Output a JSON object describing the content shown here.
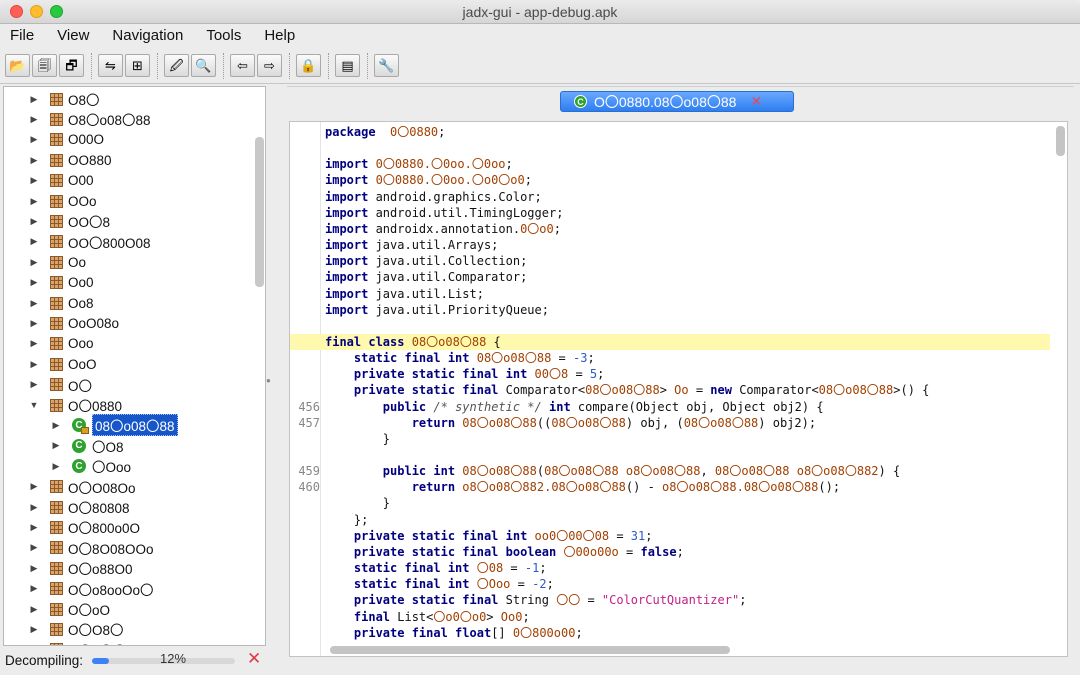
{
  "window": {
    "title": "jadx-gui - app-debug.apk"
  },
  "menu": [
    "File",
    "View",
    "Navigation",
    "Tools",
    "Help"
  ],
  "toolbar": {
    "groups": [
      [
        {
          "icon": "folder-open-icon",
          "glyph": "📂"
        },
        {
          "icon": "save-all-icon",
          "glyph": "🗐"
        },
        {
          "icon": "export-icon",
          "glyph": "🗗"
        }
      ],
      [
        {
          "icon": "sync-tree-icon",
          "glyph": "⇋"
        },
        {
          "icon": "flatten-packages-icon",
          "glyph": "⊞"
        }
      ],
      [
        {
          "icon": "search-text-icon",
          "glyph": "🖉"
        },
        {
          "icon": "search-class-icon",
          "glyph": "🔍"
        }
      ],
      [
        {
          "icon": "back-icon",
          "glyph": "⇦"
        },
        {
          "icon": "forward-icon",
          "glyph": "⇨"
        }
      ],
      [
        {
          "icon": "deobfuscation-icon",
          "glyph": "🔒"
        }
      ],
      [
        {
          "icon": "log-viewer-icon",
          "glyph": "▤"
        }
      ],
      [
        {
          "icon": "preferences-icon",
          "glyph": "🔧"
        }
      ]
    ]
  },
  "tree": [
    {
      "label": "O8〇",
      "type": "package",
      "level": 0,
      "arrow": "▶"
    },
    {
      "label": "O8〇o08〇88",
      "type": "package",
      "level": 0,
      "arrow": "▶"
    },
    {
      "label": "O00O",
      "type": "package",
      "level": 0,
      "arrow": "▶"
    },
    {
      "label": "OO880",
      "type": "package",
      "level": 0,
      "arrow": "▶"
    },
    {
      "label": "O00",
      "type": "package",
      "level": 0,
      "arrow": "▶"
    },
    {
      "label": "OOo",
      "type": "package",
      "level": 0,
      "arrow": "▶"
    },
    {
      "label": "OO〇8",
      "type": "package",
      "level": 0,
      "arrow": "▶"
    },
    {
      "label": "OO〇800O08",
      "type": "package",
      "level": 0,
      "arrow": "▶"
    },
    {
      "label": "Oo",
      "type": "package",
      "level": 0,
      "arrow": "▶"
    },
    {
      "label": "Oo0",
      "type": "package",
      "level": 0,
      "arrow": "▶"
    },
    {
      "label": "Oo8",
      "type": "package",
      "level": 0,
      "arrow": "▶"
    },
    {
      "label": "OoO08o",
      "type": "package",
      "level": 0,
      "arrow": "▶"
    },
    {
      "label": "Ooo",
      "type": "package",
      "level": 0,
      "arrow": "▶"
    },
    {
      "label": "OoO",
      "type": "package",
      "level": 0,
      "arrow": "▶"
    },
    {
      "label": "O〇",
      "type": "package",
      "level": 0,
      "arrow": "▶"
    },
    {
      "label": "O〇0880",
      "type": "package",
      "level": 0,
      "arrow": "▼"
    },
    {
      "label": "08〇o08〇88",
      "type": "class",
      "level": 1,
      "arrow": "▶",
      "selected": true,
      "lock": true
    },
    {
      "label": "〇O8",
      "type": "class",
      "level": 1,
      "arrow": "▶"
    },
    {
      "label": "〇Ooo",
      "type": "class",
      "level": 1,
      "arrow": "▶"
    },
    {
      "label": "O〇O08Oo",
      "type": "package",
      "level": 0,
      "arrow": "▶"
    },
    {
      "label": "O〇80808",
      "type": "package",
      "level": 0,
      "arrow": "▶"
    },
    {
      "label": "O〇800o0O",
      "type": "package",
      "level": 0,
      "arrow": "▶"
    },
    {
      "label": "O〇8O08OOo",
      "type": "package",
      "level": 0,
      "arrow": "▶"
    },
    {
      "label": "O〇o88O0",
      "type": "package",
      "level": 0,
      "arrow": "▶"
    },
    {
      "label": "O〇o8ooOo〇",
      "type": "package",
      "level": 0,
      "arrow": "▶"
    },
    {
      "label": "O〇oO",
      "type": "package",
      "level": 0,
      "arrow": "▶"
    },
    {
      "label": "O〇O8〇",
      "type": "package",
      "level": 0,
      "arrow": "▶"
    },
    {
      "label": "O〇0〇〇",
      "type": "package",
      "level": 0,
      "arrow": "▶"
    }
  ],
  "tab": {
    "label": "O〇0880.08〇o08〇88",
    "close": "✕",
    "icon_glyph": "C"
  },
  "code": [
    {
      "ln": "",
      "segs": [
        [
          "kw",
          "package"
        ],
        [
          "",
          "  "
        ],
        [
          "id",
          "0〇0880"
        ],
        [
          "",
          ";"
        ]
      ]
    },
    {
      "ln": "",
      "segs": []
    },
    {
      "ln": "",
      "segs": [
        [
          "kw",
          "import"
        ],
        [
          "",
          " "
        ],
        [
          "id",
          "0〇0880.〇0oo.〇0oo"
        ],
        [
          "",
          ";"
        ]
      ]
    },
    {
      "ln": "",
      "segs": [
        [
          "kw",
          "import"
        ],
        [
          "",
          " "
        ],
        [
          "id",
          "0〇0880.〇0oo.〇o0〇o0"
        ],
        [
          "",
          ";"
        ]
      ]
    },
    {
      "ln": "",
      "segs": [
        [
          "kw",
          "import"
        ],
        [
          "",
          " android.graphics.Color;"
        ]
      ]
    },
    {
      "ln": "",
      "segs": [
        [
          "kw",
          "import"
        ],
        [
          "",
          " android.util.TimingLogger;"
        ]
      ]
    },
    {
      "ln": "",
      "segs": [
        [
          "kw",
          "import"
        ],
        [
          "",
          " androidx.annotation."
        ],
        [
          "id",
          "0〇o0"
        ],
        [
          "",
          ";"
        ]
      ]
    },
    {
      "ln": "",
      "segs": [
        [
          "kw",
          "import"
        ],
        [
          "",
          " java.util.Arrays;"
        ]
      ]
    },
    {
      "ln": "",
      "segs": [
        [
          "kw",
          "import"
        ],
        [
          "",
          " java.util.Collection;"
        ]
      ]
    },
    {
      "ln": "",
      "segs": [
        [
          "kw",
          "import"
        ],
        [
          "",
          " java.util.Comparator;"
        ]
      ]
    },
    {
      "ln": "",
      "segs": [
        [
          "kw",
          "import"
        ],
        [
          "",
          " java.util.List;"
        ]
      ]
    },
    {
      "ln": "",
      "segs": [
        [
          "kw",
          "import"
        ],
        [
          "",
          " java.util.PriorityQueue;"
        ]
      ]
    },
    {
      "ln": "",
      "segs": []
    },
    {
      "ln": "",
      "hl": true,
      "segs": [
        [
          "kw",
          "final class"
        ],
        [
          "",
          " "
        ],
        [
          "id",
          "08〇o08〇88"
        ],
        [
          "",
          " {"
        ]
      ]
    },
    {
      "ln": "",
      "segs": [
        [
          "",
          "    "
        ],
        [
          "kw",
          "static final int"
        ],
        [
          "",
          " "
        ],
        [
          "id",
          "08〇o08〇88"
        ],
        [
          "",
          " = "
        ],
        [
          "num",
          "-3"
        ],
        [
          "",
          ";"
        ]
      ]
    },
    {
      "ln": "",
      "segs": [
        [
          "",
          "    "
        ],
        [
          "kw",
          "private static final int"
        ],
        [
          "",
          " "
        ],
        [
          "id",
          "00〇8"
        ],
        [
          "",
          " = "
        ],
        [
          "num",
          "5"
        ],
        [
          "",
          ";"
        ]
      ]
    },
    {
      "ln": "",
      "segs": [
        [
          "",
          "    "
        ],
        [
          "kw",
          "private static final"
        ],
        [
          "",
          " Comparator<"
        ],
        [
          "id",
          "08〇o08〇88"
        ],
        [
          "",
          "> "
        ],
        [
          "id",
          "Oo"
        ],
        [
          "",
          " = "
        ],
        [
          "kw",
          "new"
        ],
        [
          "",
          " Comparator<"
        ],
        [
          "id",
          "08〇o08〇88"
        ],
        [
          "",
          ">() {"
        ]
      ]
    },
    {
      "ln": "456",
      "segs": [
        [
          "",
          "        "
        ],
        [
          "kw",
          "public"
        ],
        [
          "",
          " "
        ],
        [
          "cm",
          "/* synthetic */"
        ],
        [
          "",
          " "
        ],
        [
          "kw",
          "int"
        ],
        [
          "",
          " compare(Object obj, Object obj2) {"
        ]
      ]
    },
    {
      "ln": "457",
      "segs": [
        [
          "",
          "            "
        ],
        [
          "kw",
          "return"
        ],
        [
          "",
          " "
        ],
        [
          "id",
          "08〇o08〇88"
        ],
        [
          "",
          "(("
        ],
        [
          "id",
          "08〇o08〇88"
        ],
        [
          "",
          ") obj, ("
        ],
        [
          "id",
          "08〇o08〇88"
        ],
        [
          "",
          ") obj2);"
        ]
      ]
    },
    {
      "ln": "",
      "segs": [
        [
          "",
          "        }"
        ]
      ]
    },
    {
      "ln": "",
      "segs": []
    },
    {
      "ln": "459",
      "segs": [
        [
          "",
          "        "
        ],
        [
          "kw",
          "public int"
        ],
        [
          "",
          " "
        ],
        [
          "id",
          "08〇o08〇88"
        ],
        [
          "",
          "("
        ],
        [
          "id",
          "08〇o08〇88 o8〇o08〇88"
        ],
        [
          "",
          ", "
        ],
        [
          "id",
          "08〇o08〇88 o8〇o08〇882"
        ],
        [
          "",
          ") {"
        ]
      ]
    },
    {
      "ln": "460",
      "segs": [
        [
          "",
          "            "
        ],
        [
          "kw",
          "return"
        ],
        [
          "",
          " "
        ],
        [
          "id",
          "o8〇o08〇882.08〇o08〇88"
        ],
        [
          "",
          "() - "
        ],
        [
          "id",
          "o8〇o08〇88.08〇o08〇88"
        ],
        [
          "",
          "();"
        ]
      ]
    },
    {
      "ln": "",
      "segs": [
        [
          "",
          "        }"
        ]
      ]
    },
    {
      "ln": "",
      "segs": [
        [
          "",
          "    };"
        ]
      ]
    },
    {
      "ln": "",
      "segs": [
        [
          "",
          "    "
        ],
        [
          "kw",
          "private static final int"
        ],
        [
          "",
          " "
        ],
        [
          "id",
          "oo0〇00〇08"
        ],
        [
          "",
          " = "
        ],
        [
          "num",
          "31"
        ],
        [
          "",
          ";"
        ]
      ]
    },
    {
      "ln": "",
      "segs": [
        [
          "",
          "    "
        ],
        [
          "kw",
          "private static final boolean"
        ],
        [
          "",
          " "
        ],
        [
          "id",
          "〇00o00o"
        ],
        [
          "",
          " = "
        ],
        [
          "kw",
          "false"
        ],
        [
          "",
          ";"
        ]
      ]
    },
    {
      "ln": "",
      "segs": [
        [
          "",
          "    "
        ],
        [
          "kw",
          "static final int"
        ],
        [
          "",
          " "
        ],
        [
          "id",
          "〇08"
        ],
        [
          "",
          " = "
        ],
        [
          "num",
          "-1"
        ],
        [
          "",
          ";"
        ]
      ]
    },
    {
      "ln": "",
      "segs": [
        [
          "",
          "    "
        ],
        [
          "kw",
          "static final int"
        ],
        [
          "",
          " "
        ],
        [
          "id",
          "〇Ooo"
        ],
        [
          "",
          " = "
        ],
        [
          "num",
          "-2"
        ],
        [
          "",
          ";"
        ]
      ]
    },
    {
      "ln": "",
      "segs": [
        [
          "",
          "    "
        ],
        [
          "kw",
          "private static final"
        ],
        [
          "",
          " String "
        ],
        [
          "id",
          "〇〇"
        ],
        [
          "",
          " = "
        ],
        [
          "str",
          "\"ColorCutQuantizer\""
        ],
        [
          "",
          ";"
        ]
      ]
    },
    {
      "ln": "",
      "segs": [
        [
          "",
          "    "
        ],
        [
          "kw",
          "final"
        ],
        [
          "",
          " List<"
        ],
        [
          "id",
          "〇o0〇o0"
        ],
        [
          "",
          "> "
        ],
        [
          "id",
          "Oo0"
        ],
        [
          "",
          ";"
        ]
      ]
    },
    {
      "ln": "",
      "segs": [
        [
          "",
          "    "
        ],
        [
          "kw",
          "private final float"
        ],
        [
          "",
          "[] "
        ],
        [
          "id",
          "0〇800o00"
        ],
        [
          "",
          ";"
        ]
      ]
    }
  ],
  "status": {
    "label": "Decompiling:",
    "percent_text": "12%",
    "progress": 0.12,
    "cancel": "✕"
  }
}
